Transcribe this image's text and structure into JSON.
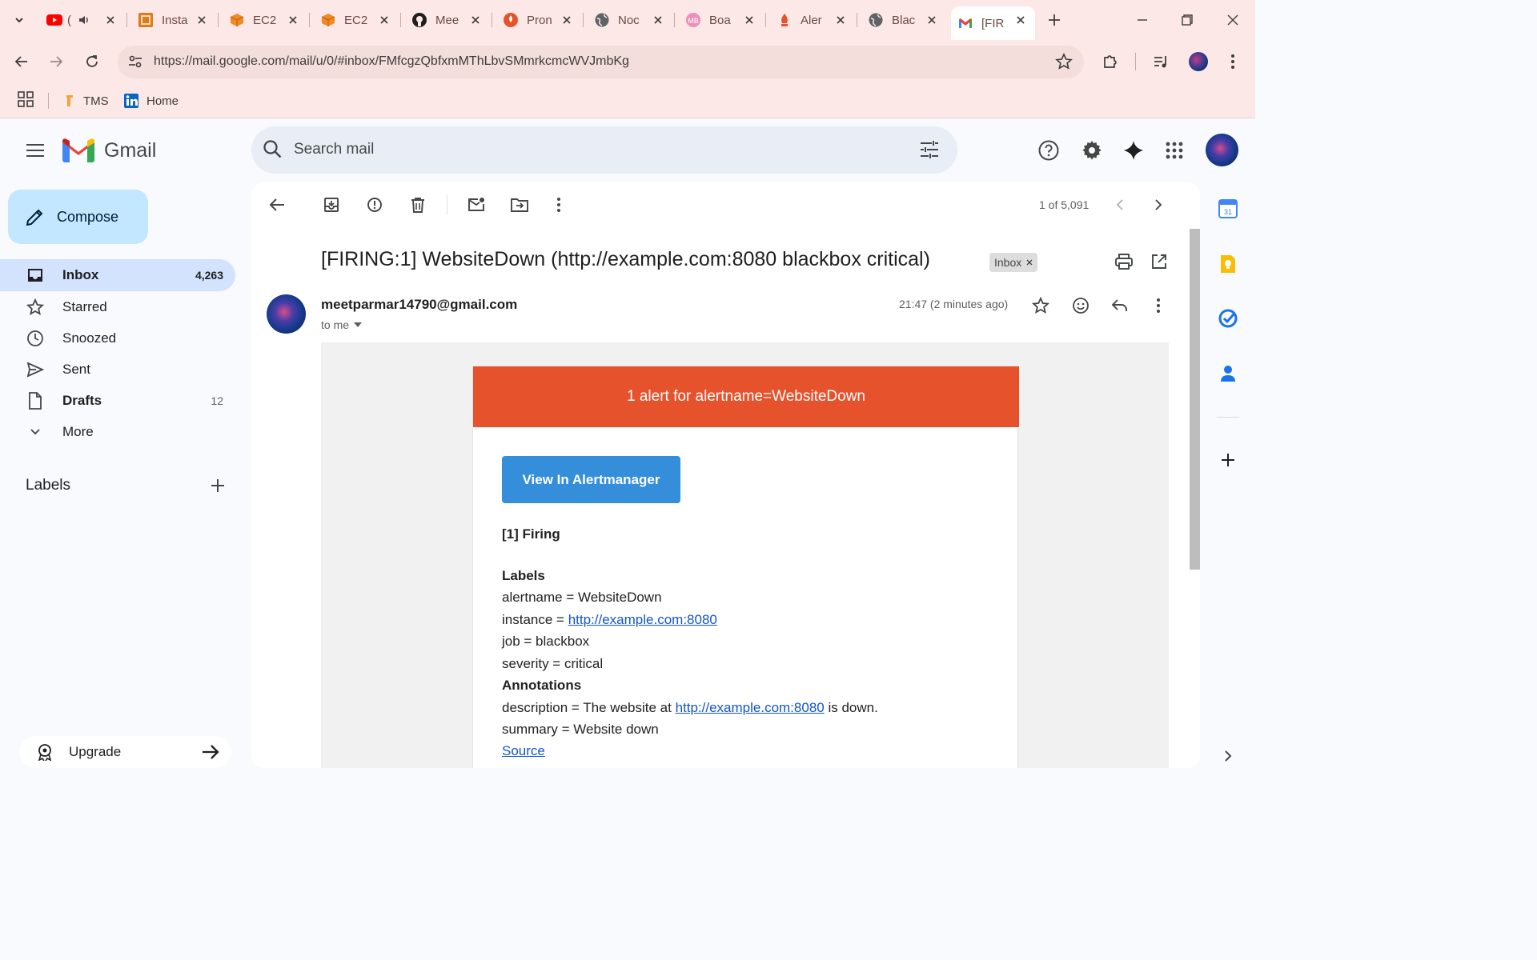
{
  "browser": {
    "tabs": [
      {
        "label": "(",
        "icon": "youtube-icon"
      },
      {
        "label": "Insta",
        "icon": "instance-icon"
      },
      {
        "label": "EC2",
        "icon": "aws-cube-icon"
      },
      {
        "label": "EC2",
        "icon": "aws-cube-icon"
      },
      {
        "label": "Mee",
        "icon": "github-icon"
      },
      {
        "label": "Pron",
        "icon": "prometheus-icon"
      },
      {
        "label": "Noc",
        "icon": "globe-icon"
      },
      {
        "label": "Boa",
        "icon": "metabase-icon"
      },
      {
        "label": "Aler",
        "icon": "prometheus-icon"
      },
      {
        "label": "Blac",
        "icon": "globe-icon"
      },
      {
        "label": "[FIR",
        "icon": "gmail-icon"
      }
    ],
    "url": "https://mail.google.com/mail/u/0/#inbox/FMfcgzQbfxmMThLbvSMmrkcmcWVJmbKg",
    "bookmarks": [
      {
        "label": "TMS"
      },
      {
        "label": "Home"
      }
    ]
  },
  "gmail": {
    "brand": "Gmail",
    "search_placeholder": "Search mail",
    "compose": "Compose",
    "nav": [
      {
        "label": "Inbox",
        "count": "4,263",
        "bold": true
      },
      {
        "label": "Starred",
        "count": ""
      },
      {
        "label": "Snoozed",
        "count": ""
      },
      {
        "label": "Sent",
        "count": ""
      },
      {
        "label": "Drafts",
        "count": "12",
        "bold": true
      },
      {
        "label": "More",
        "count": ""
      }
    ],
    "labels_title": "Labels",
    "upgrade": "Upgrade",
    "pagination": "1 of 5,091"
  },
  "email": {
    "subject": "[FIRING:1] WebsiteDown (http://example.com:8080 blackbox critical)",
    "chip": "Inbox",
    "sender": "meetparmar14790@gmail.com",
    "to": "to me",
    "time": "21:47 (2 minutes ago)",
    "header": "1 alert for alertname=WebsiteDown",
    "button": "View In Alertmanager",
    "firing": "[1] Firing",
    "labels_heading": "Labels",
    "l1": "alertname = WebsiteDown",
    "l2_prefix": "instance = ",
    "l2_link": "http://example.com:8080",
    "l3": "job = blackbox",
    "l4": "severity = critical",
    "annotations_heading": "Annotations",
    "d_prefix": "description = The website at ",
    "d_link": "http://example.com:8080",
    "d_suffix": " is down.",
    "summary": "summary = Website down",
    "source": "Source"
  },
  "colors": {
    "alert_header": "#e6522c",
    "alertmanager_button": "#348eda",
    "inbox_selected": "#d3e3fd",
    "compose_bg": "#c2e7ff"
  }
}
